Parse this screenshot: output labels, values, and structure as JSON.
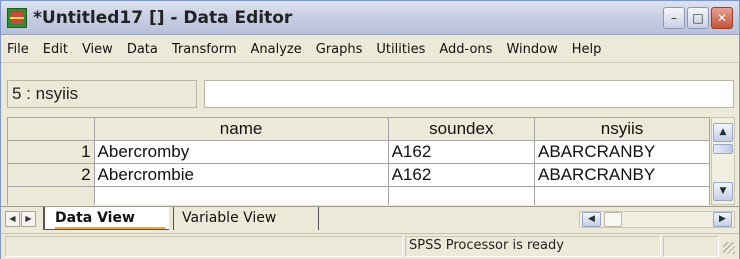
{
  "window": {
    "title": "*Untitled17 [] - Data Editor",
    "controls": {
      "minimize": "–",
      "maximize": "□",
      "close": "✕"
    }
  },
  "menu": [
    "File",
    "Edit",
    "View",
    "Data",
    "Transform",
    "Analyze",
    "Graphs",
    "Utilities",
    "Add-ons",
    "Window",
    "Help"
  ],
  "cell_editor": {
    "reference": "5 : nsyiis",
    "value": ""
  },
  "grid": {
    "columns": [
      "name",
      "soundex",
      "nsyiis"
    ],
    "rows": [
      {
        "num": "1",
        "cells": [
          "Abercromby",
          "A162",
          "ABARCRANBY"
        ]
      },
      {
        "num": "2",
        "cells": [
          "Abercrombie",
          "A162",
          "ABARCRANBY"
        ]
      }
    ]
  },
  "tabs": {
    "data_view": "Data View",
    "variable_view": "Variable View"
  },
  "status": {
    "text": "SPSS Processor is ready"
  },
  "icons": {
    "app": "spss-app-icon",
    "minimize": "minimize-icon",
    "maximize": "maximize-icon",
    "close": "close-icon",
    "scroll_up": "chevron-up-icon",
    "scroll_down": "chevron-down-icon",
    "scroll_left": "chevron-left-icon",
    "scroll_right": "chevron-right-icon"
  },
  "colors": {
    "title_gradient_top": "#dfe3f0",
    "active_tab_underline": "#e3a93a",
    "chrome": "#ece9d8"
  }
}
